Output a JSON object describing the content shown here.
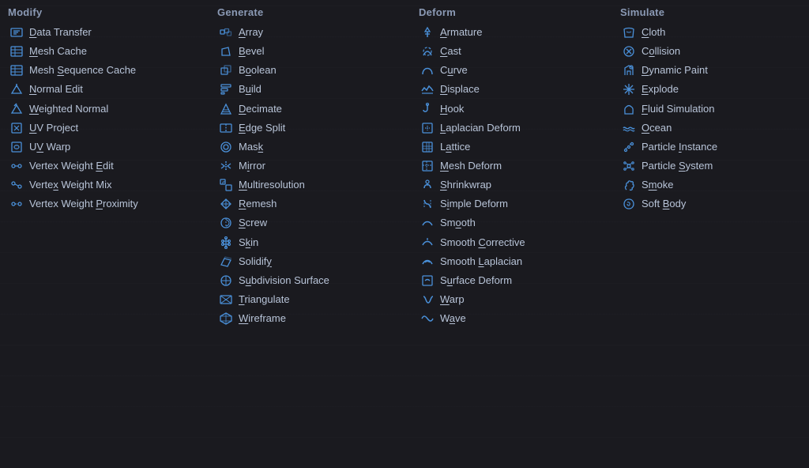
{
  "columns": [
    {
      "id": "modify",
      "header": "Modify",
      "items": [
        {
          "label": "Data Transfer",
          "underline": "D",
          "icon": "data-transfer"
        },
        {
          "label": "Mesh Cache",
          "underline": "M",
          "icon": "mesh-cache"
        },
        {
          "label": "Mesh Sequence Cache",
          "underline": "S",
          "icon": "mesh-seq-cache"
        },
        {
          "label": "Normal Edit",
          "underline": "N",
          "icon": "normal-edit"
        },
        {
          "label": "Weighted Normal",
          "underline": "W",
          "icon": "weighted-normal"
        },
        {
          "label": "UV Project",
          "underline": "U",
          "icon": "uv-project"
        },
        {
          "label": "UV Warp",
          "underline": "V",
          "icon": "uv-warp"
        },
        {
          "label": "Vertex Weight Edit",
          "underline": "E",
          "icon": "vertex-weight-edit"
        },
        {
          "label": "Vertex Weight Mix",
          "underline": "x",
          "icon": "vertex-weight-mix"
        },
        {
          "label": "Vertex Weight Proximity",
          "underline": "P",
          "icon": "vertex-weight-prox"
        }
      ]
    },
    {
      "id": "generate",
      "header": "Generate",
      "items": [
        {
          "label": "Array",
          "underline": "A",
          "icon": "array"
        },
        {
          "label": "Bevel",
          "underline": "B",
          "icon": "bevel"
        },
        {
          "label": "Boolean",
          "underline": "o",
          "icon": "boolean"
        },
        {
          "label": "Build",
          "underline": "u",
          "icon": "build"
        },
        {
          "label": "Decimate",
          "underline": "D",
          "icon": "decimate"
        },
        {
          "label": "Edge Split",
          "underline": "E",
          "icon": "edge-split"
        },
        {
          "label": "Mask",
          "underline": "k",
          "icon": "mask"
        },
        {
          "label": "Mirror",
          "underline": "i",
          "icon": "mirror"
        },
        {
          "label": "Multiresolution",
          "underline": "M",
          "icon": "multiresolution"
        },
        {
          "label": "Remesh",
          "underline": "R",
          "icon": "remesh"
        },
        {
          "label": "Screw",
          "underline": "S",
          "icon": "screw"
        },
        {
          "label": "Skin",
          "underline": "k",
          "icon": "skin"
        },
        {
          "label": "Solidify",
          "underline": "y",
          "icon": "solidify"
        },
        {
          "label": "Subdivision Surface",
          "underline": "u",
          "icon": "subdivision"
        },
        {
          "label": "Triangulate",
          "underline": "T",
          "icon": "triangulate"
        },
        {
          "label": "Wireframe",
          "underline": "W",
          "icon": "wireframe"
        }
      ]
    },
    {
      "id": "deform",
      "header": "Deform",
      "items": [
        {
          "label": "Armature",
          "underline": "A",
          "icon": "armature"
        },
        {
          "label": "Cast",
          "underline": "C",
          "icon": "cast"
        },
        {
          "label": "Curve",
          "underline": "u",
          "icon": "curve"
        },
        {
          "label": "Displace",
          "underline": "D",
          "icon": "displace"
        },
        {
          "label": "Hook",
          "underline": "H",
          "icon": "hook"
        },
        {
          "label": "Laplacian Deform",
          "underline": "L",
          "icon": "laplacian-deform"
        },
        {
          "label": "Lattice",
          "underline": "a",
          "icon": "lattice"
        },
        {
          "label": "Mesh Deform",
          "underline": "M",
          "icon": "mesh-deform"
        },
        {
          "label": "Shrinkwrap",
          "underline": "S",
          "icon": "shrinkwrap"
        },
        {
          "label": "Simple Deform",
          "underline": "i",
          "icon": "simple-deform"
        },
        {
          "label": "Smooth",
          "underline": "o",
          "icon": "smooth"
        },
        {
          "label": "Smooth Corrective",
          "underline": "C",
          "icon": "smooth-corrective"
        },
        {
          "label": "Smooth Laplacian",
          "underline": "L",
          "icon": "smooth-laplacian"
        },
        {
          "label": "Surface Deform",
          "underline": "u",
          "icon": "surface-deform"
        },
        {
          "label": "Warp",
          "underline": "W",
          "icon": "warp"
        },
        {
          "label": "Wave",
          "underline": "a",
          "icon": "wave"
        }
      ]
    },
    {
      "id": "simulate",
      "header": "Simulate",
      "items": [
        {
          "label": "Cloth",
          "underline": "C",
          "icon": "cloth"
        },
        {
          "label": "Collision",
          "underline": "o",
          "icon": "collision"
        },
        {
          "label": "Dynamic Paint",
          "underline": "D",
          "icon": "dynamic-paint"
        },
        {
          "label": "Explode",
          "underline": "E",
          "icon": "explode"
        },
        {
          "label": "Fluid Simulation",
          "underline": "F",
          "icon": "fluid-sim"
        },
        {
          "label": "Ocean",
          "underline": "O",
          "icon": "ocean"
        },
        {
          "label": "Particle Instance",
          "underline": "I",
          "icon": "particle-instance"
        },
        {
          "label": "Particle System",
          "underline": "S",
          "icon": "particle-system"
        },
        {
          "label": "Smoke",
          "underline": "m",
          "icon": "smoke"
        },
        {
          "label": "Soft Body",
          "underline": "B",
          "icon": "soft-body"
        }
      ]
    }
  ]
}
